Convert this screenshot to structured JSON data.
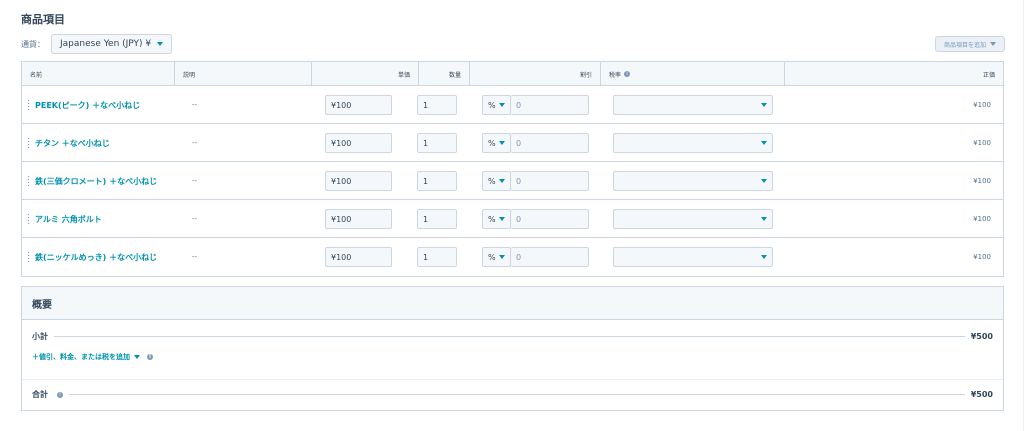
{
  "section": {
    "title": "商品項目"
  },
  "currency": {
    "label": "通貨：",
    "value": "Japanese Yen (JPY) ¥"
  },
  "add_product_button": "商品項目を追加",
  "columns": {
    "name": "名前",
    "description": "説明",
    "unit_price": "単価",
    "quantity": "数量",
    "discount": "割引",
    "tax_rate": "税率",
    "net_price": "正価"
  },
  "rows": [
    {
      "name": "PEEK(ピーク) ＋なべ小ねじ",
      "description": "--",
      "unit_price": "¥100",
      "quantity": "1",
      "discount_type": "%",
      "discount": "0",
      "tax": "",
      "total": "¥100"
    },
    {
      "name": "チタン ＋なべ小ねじ",
      "description": "--",
      "unit_price": "¥100",
      "quantity": "1",
      "discount_type": "%",
      "discount": "0",
      "tax": "",
      "total": "¥100"
    },
    {
      "name": "鉄(三価クロメート) ＋なべ小ねじ",
      "description": "--",
      "unit_price": "¥100",
      "quantity": "1",
      "discount_type": "%",
      "discount": "0",
      "tax": "",
      "total": "¥100"
    },
    {
      "name": "アルミ 六角ボルト",
      "description": "--",
      "unit_price": "¥100",
      "quantity": "1",
      "discount_type": "%",
      "discount": "0",
      "tax": "",
      "total": "¥100"
    },
    {
      "name": "鉄(ニッケルめっき) ＋なべ小ねじ",
      "description": "--",
      "unit_price": "¥100",
      "quantity": "1",
      "discount_type": "%",
      "discount": "0",
      "tax": "",
      "total": "¥100"
    }
  ],
  "summary": {
    "title": "概要",
    "subtotal_label": "小計",
    "subtotal_value": "¥500",
    "add_discount_link": "＋値引、料金、または税を追加",
    "total_label": "合計",
    "total_value": "¥500"
  },
  "colors": {
    "link": "#0091ae",
    "text": "#33475b",
    "border": "#cbd6e2",
    "header_bg": "#f5f8fa"
  }
}
